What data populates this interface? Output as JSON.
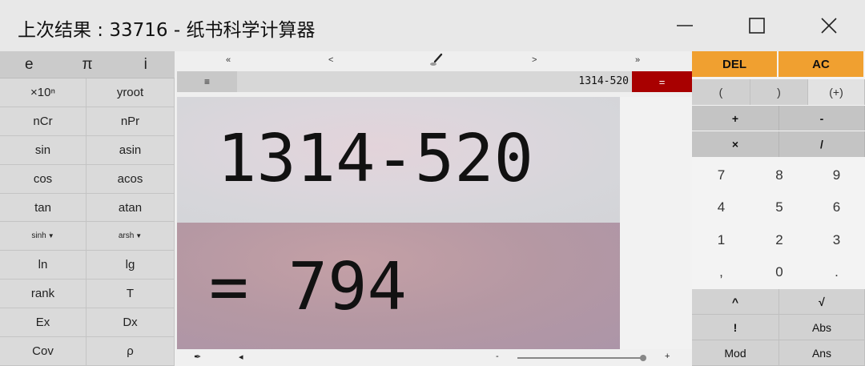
{
  "window": {
    "title": "上次结果 : 33716 - 纸书科学计算器",
    "minimize_icon": "minimize-icon",
    "maximize_icon": "maximize-icon",
    "close_icon": "close-icon"
  },
  "left_panel": {
    "constants": [
      "e",
      "π",
      "i"
    ],
    "functions": [
      [
        "×10ⁿ",
        "yroot"
      ],
      [
        "nCr",
        "nPr"
      ],
      [
        "sin",
        "asin"
      ],
      [
        "cos",
        "acos"
      ],
      [
        "tan",
        "atan"
      ],
      [
        "sinh",
        "arsh"
      ],
      [
        "ln",
        "lg"
      ],
      [
        "rank",
        "T"
      ],
      [
        "Ex",
        "Dx"
      ],
      [
        "Cov",
        "ρ"
      ]
    ]
  },
  "center": {
    "nav": {
      "first": "«",
      "prev": "<",
      "brush_icon": "brush-icon",
      "next": ">",
      "last": "»"
    },
    "menu_label": "≡",
    "expression": "1314-520",
    "equals_label": "=",
    "display_expression": "1314-520",
    "display_result": "= 794",
    "bottom": {
      "pin": "✒",
      "left_arrow": "◂",
      "zoom_minus": "-",
      "zoom_plus": "+",
      "zoom_level": 0.98
    }
  },
  "right_panel": {
    "del_label": "DEL",
    "ac_label": "AC",
    "parens": [
      "(",
      ")",
      "(+)"
    ],
    "op_row1": [
      "+",
      "-"
    ],
    "op_row2": [
      "×",
      "/"
    ],
    "digits": [
      [
        "7",
        "8",
        "9"
      ],
      [
        "4",
        "5",
        "6"
      ],
      [
        "1",
        "2",
        "3"
      ],
      [
        ",",
        "0",
        "."
      ]
    ],
    "func_row1": [
      "^",
      "√"
    ],
    "func_row2": [
      "!",
      "Abs"
    ],
    "func_row3": [
      "Mod",
      "Ans"
    ]
  },
  "colors": {
    "accent_orange": "#f0a030",
    "equals_red": "#a80000",
    "result_bg": "#b598a3"
  }
}
